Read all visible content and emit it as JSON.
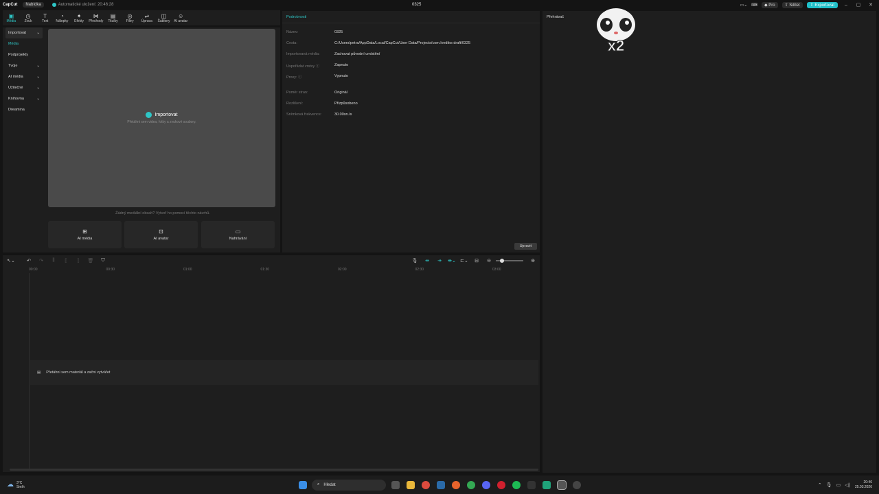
{
  "titlebar": {
    "app_logo": "CapCut",
    "menu": "Nabídka",
    "autosave": "Automatické uložení: 20:46:28",
    "project_title": "0325",
    "pro": "Pro",
    "share": "Sdílet",
    "export": "Exportovat"
  },
  "toolbar": {
    "items": [
      {
        "label": "Média",
        "icon": "media-icon",
        "glyph": "▣"
      },
      {
        "label": "Zvuk",
        "icon": "audio-icon",
        "glyph": "◷"
      },
      {
        "label": "Text",
        "icon": "text-icon",
        "glyph": "T"
      },
      {
        "label": "Nálepky",
        "icon": "sticker-icon",
        "glyph": "◔"
      },
      {
        "label": "Efekty",
        "icon": "effects-icon",
        "glyph": "✦"
      },
      {
        "label": "Přechody",
        "icon": "transitions-icon",
        "glyph": "⋈"
      },
      {
        "label": "Titulky",
        "icon": "captions-icon",
        "glyph": "▤"
      },
      {
        "label": "Filtry",
        "icon": "filters-icon",
        "glyph": "◎"
      },
      {
        "label": "Úprava",
        "icon": "adjust-icon",
        "glyph": "⇌"
      },
      {
        "label": "Šablony",
        "icon": "templates-icon",
        "glyph": "◫"
      },
      {
        "label": "AI avatar",
        "icon": "ai-avatar-icon",
        "glyph": "☺"
      }
    ]
  },
  "sidebar": {
    "items": [
      {
        "label": "Importovat",
        "chevron": "⌄"
      },
      {
        "label": "Média",
        "chevron": ""
      },
      {
        "label": "Podprojekty",
        "chevron": ""
      },
      {
        "label": "Tvoje",
        "chevron": "⌄"
      },
      {
        "label": "AI média",
        "chevron": "⌄"
      },
      {
        "label": "Užitečné",
        "chevron": "⌄"
      },
      {
        "label": "Knihovna",
        "chevron": "⌄"
      },
      {
        "label": "Dreamina",
        "chevron": ""
      }
    ]
  },
  "media": {
    "import_label": "Importovat",
    "drop_hint": "Přetáhni sem videa, fotky a zvukové soubory.",
    "empty_hint": "Žádný mediální obsah? Vytvoř ho pomocí těchto návrhů.",
    "cards": [
      "AI média",
      "AI avatar",
      "Nahrávání"
    ]
  },
  "details": {
    "title": "Podrobnosti",
    "rows": [
      {
        "key": "Název:",
        "value": "0325"
      },
      {
        "key": "Cesta:",
        "value": "C:/Users/petra/AppData/Local/CapCut/User Data/Projects/com.lveditor.draft/0325"
      },
      {
        "key": "Importovaná média:",
        "value": "Zachovat původní umístění"
      },
      {
        "key": "Uspořádat vrstvy ⓘ",
        "value": "Zapnuto"
      },
      {
        "key": "Proxy: ⓘ",
        "value": "Vypnuto"
      },
      {
        "key": "Poměr stran:",
        "value": "Originál"
      },
      {
        "key": "Rozlišení:",
        "value": "Přizpůsobeno"
      },
      {
        "key": "Snímková frekvence:",
        "value": "30.00sn./s"
      }
    ],
    "edit": "Upravit"
  },
  "player": {
    "title": "Přehrávač",
    "sticker_text": "x2"
  },
  "timeline": {
    "ruler": [
      "00:00",
      "00:30",
      "01:00",
      "01:30",
      "02:00",
      "02:30",
      "03:00"
    ],
    "drop_hint": "Přetáhni sem materiál a začni vytvářet"
  },
  "taskbar": {
    "temperature": "3°C",
    "weather": "Smíh",
    "search": "Hledat",
    "time": "20:46",
    "date": "25.03.2026"
  },
  "colors": {
    "accent": "#2ec6c6",
    "export": "#1fbfc8",
    "panel": "#1e1e1e",
    "background": "#141414"
  }
}
